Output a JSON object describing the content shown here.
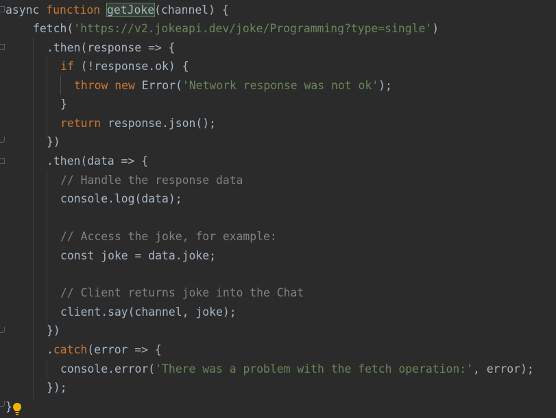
{
  "editor": {
    "lines": [
      {
        "tokens": [
          {
            "t": "async ",
            "c": "kw2"
          },
          {
            "t": "function ",
            "c": "kw"
          },
          {
            "t": "getJoke",
            "c": "hl"
          },
          {
            "t": "(channel) {",
            "c": "fn"
          }
        ]
      },
      {
        "tokens": [
          {
            "t": "fetch(",
            "c": "fn"
          },
          {
            "t": "'https://v2.jokeapi.dev/joke/Programming?type=single'",
            "c": "str"
          },
          {
            "t": ")",
            "c": "fn"
          }
        ]
      },
      {
        "tokens": [
          {
            "t": ".then(response => {",
            "c": "fn"
          }
        ]
      },
      {
        "tokens": [
          {
            "t": "if ",
            "c": "kw"
          },
          {
            "t": "(!response.ok) {",
            "c": "fn"
          }
        ]
      },
      {
        "tokens": [
          {
            "t": "throw ",
            "c": "kw"
          },
          {
            "t": "new ",
            "c": "kw"
          },
          {
            "t": "Error(",
            "c": "fn"
          },
          {
            "t": "'Network response was not ok'",
            "c": "str"
          },
          {
            "t": ");",
            "c": "fn"
          }
        ]
      },
      {
        "tokens": [
          {
            "t": "}",
            "c": "fn"
          }
        ]
      },
      {
        "tokens": [
          {
            "t": "return ",
            "c": "kw"
          },
          {
            "t": "response.json();",
            "c": "fn"
          }
        ]
      },
      {
        "tokens": [
          {
            "t": "})",
            "c": "fn"
          }
        ]
      },
      {
        "tokens": [
          {
            "t": ".then(data => {",
            "c": "fn"
          }
        ]
      },
      {
        "tokens": [
          {
            "t": "// Handle the response data",
            "c": "com"
          }
        ]
      },
      {
        "tokens": [
          {
            "t": "console.log(data);",
            "c": "fn"
          }
        ]
      },
      {
        "tokens": []
      },
      {
        "tokens": [
          {
            "t": "// Access the joke, for example:",
            "c": "com"
          }
        ]
      },
      {
        "tokens": [
          {
            "t": "const joke = data.joke;",
            "c": "fn"
          }
        ]
      },
      {
        "tokens": []
      },
      {
        "tokens": [
          {
            "t": "// Client returns joke into the Chat",
            "c": "com"
          }
        ]
      },
      {
        "tokens": [
          {
            "t": "client.say(channel, joke);",
            "c": "fn"
          }
        ]
      },
      {
        "tokens": [
          {
            "t": "})",
            "c": "fn"
          }
        ]
      },
      {
        "tokens": [
          {
            "t": ".",
            "c": "fn"
          },
          {
            "t": "catch",
            "c": "kw"
          },
          {
            "t": "(error => {",
            "c": "fn"
          }
        ]
      },
      {
        "tokens": [
          {
            "t": "console.error(",
            "c": "fn"
          },
          {
            "t": "'There was a problem with the fetch operation:'",
            "c": "str"
          },
          {
            "t": ", error);",
            "c": "fn"
          }
        ]
      },
      {
        "tokens": [
          {
            "t": "});",
            "c": "fn"
          }
        ]
      },
      {
        "tokens": [
          {
            "t": "}",
            "c": "fn"
          }
        ]
      }
    ]
  },
  "intention_bulb": "lightbulb-icon",
  "colors": {
    "background": "#2b2b2b",
    "keyword": "#cc7832",
    "string": "#6a8759",
    "comment": "#808080",
    "text": "#a9b7c6"
  }
}
